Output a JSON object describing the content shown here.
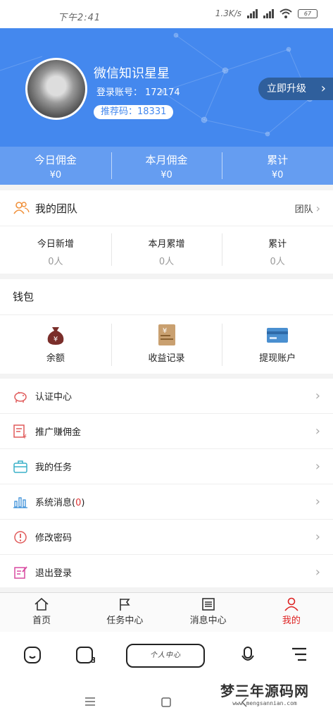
{
  "status": {
    "time": "下午2:41",
    "speed": "1.3K/s",
    "battery": "67"
  },
  "profile": {
    "name": "微信知识星星",
    "account_label": "登录账号：",
    "account": "172174",
    "ref_label": "推荐码：",
    "ref_code": "18331",
    "upgrade": "立即升级"
  },
  "commission": [
    {
      "label": "今日佣金",
      "value": "¥0"
    },
    {
      "label": "本月佣金",
      "value": "¥0"
    },
    {
      "label": "累计",
      "value": "¥0"
    }
  ],
  "team": {
    "title": "我的团队",
    "link": "团队",
    "stats": [
      {
        "label": "今日新增",
        "value": "0人"
      },
      {
        "label": "本月累增",
        "value": "0人"
      },
      {
        "label": "累计",
        "value": "0人"
      }
    ]
  },
  "wallet": {
    "title": "钱包",
    "items": [
      {
        "label": "余额",
        "icon": "money-bag-icon"
      },
      {
        "label": "收益记录",
        "icon": "receipt-icon"
      },
      {
        "label": "提现账户",
        "icon": "card-icon"
      }
    ]
  },
  "menu": [
    {
      "label": "认证中心",
      "icon": "piggy-icon"
    },
    {
      "label": "推广赚佣金",
      "icon": "invoice-icon"
    },
    {
      "label": "我的任务",
      "icon": "briefcase-icon"
    },
    {
      "label": "系统消息",
      "count": "0",
      "icon": "bar-chart-icon"
    },
    {
      "label": "修改密码",
      "icon": "info-circle-icon"
    },
    {
      "label": "退出登录",
      "icon": "edit-icon"
    }
  ],
  "tabs": [
    {
      "label": "首页"
    },
    {
      "label": "任务中心"
    },
    {
      "label": "消息中心"
    },
    {
      "label": "我的"
    }
  ],
  "nav": {
    "pill": "个人中心"
  },
  "watermark": {
    "title": "梦三年源码网",
    "url": "www.mengsannian.com"
  },
  "colors": {
    "primary": "#4488ee",
    "active_tab": "#dd2222"
  }
}
